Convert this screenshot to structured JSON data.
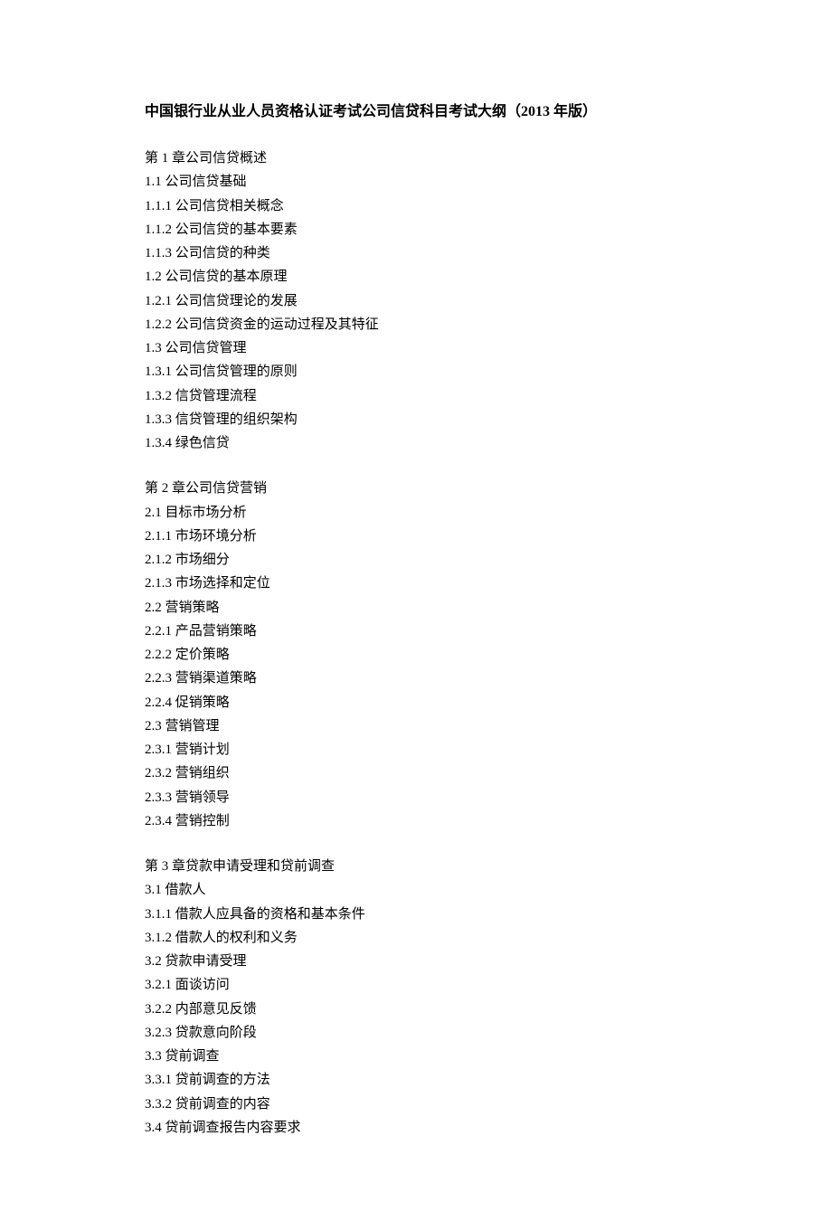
{
  "title": "中国银行业从业人员资格认证考试公司信贷科目考试大纲（2013 年版）",
  "sections": [
    {
      "lines": [
        "第 1 章公司信贷概述",
        "1.1 公司信贷基础",
        "1.1.1 公司信贷相关概念",
        "1.1.2 公司信贷的基本要素",
        "1.1.3 公司信贷的种类",
        "1.2 公司信贷的基本原理",
        "1.2.1 公司信贷理论的发展",
        "1.2.2 公司信贷资金的运动过程及其特征",
        "1.3 公司信贷管理",
        "1.3.1 公司信贷管理的原则",
        "1.3.2 信贷管理流程",
        "1.3.3 信贷管理的组织架构",
        "1.3.4 绿色信贷"
      ]
    },
    {
      "lines": [
        "第 2 章公司信贷营销",
        "2.1 目标市场分析",
        "2.1.1 市场环境分析",
        "2.1.2 市场细分",
        "2.1.3 市场选择和定位",
        "2.2 营销策略",
        "2.2.1 产品营销策略",
        "2.2.2 定价策略",
        "2.2.3 营销渠道策略",
        "2.2.4 促销策略",
        "2.3 营销管理",
        "2.3.1 营销计划",
        "2.3.2 营销组织",
        "2.3.3 营销领导",
        "2.3.4 营销控制"
      ]
    },
    {
      "lines": [
        "第 3 章贷款申请受理和贷前调查",
        "3.1 借款人",
        "3.1.1 借款人应具备的资格和基本条件",
        "3.1.2 借款人的权利和义务",
        "3.2 贷款申请受理",
        "3.2.1 面谈访问",
        "3.2.2 内部意见反馈",
        "3.2.3 贷款意向阶段",
        "3.3 贷前调查",
        "3.3.1 贷前调查的方法",
        "3.3.2 贷前调查的内容",
        "3.4 贷前调查报告内容要求"
      ]
    }
  ]
}
